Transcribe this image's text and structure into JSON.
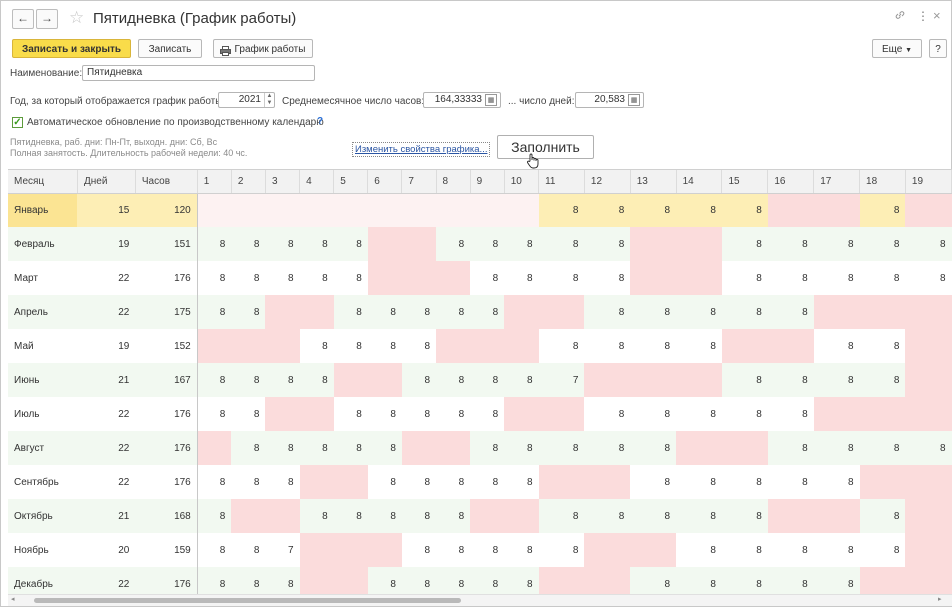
{
  "window": {
    "title": "Пятидневка (График работы)",
    "back_icon": "←",
    "forward_icon": "→",
    "star_icon": "☆",
    "link_icon": "🔗",
    "menu_icon": "⋮",
    "close_icon": "×"
  },
  "toolbar": {
    "save_close": "Записать и закрыть",
    "save": "Записать",
    "schedule": "График работы",
    "more": "Еще",
    "help": "?"
  },
  "form": {
    "name_label": "Наименование:",
    "name_value": "Пятидневка",
    "year_label": "Год, за который отображается график работы:",
    "year_value": "2021",
    "avg_hours_label": "Среднемесячное число часов:",
    "avg_hours_value": "164,33333",
    "avg_days_label": "... число дней:",
    "avg_days_value": "20,583",
    "auto_update_label": "Автоматическое обновление по производственному календарю",
    "auto_update_help": "?",
    "auto_update_checked": true,
    "info_line1": "Пятидневка, раб. дни: Пн-Пт, выходн. дни: Сб, Вс",
    "info_line2": "Полная занятость. Длительность рабочей недели: 40 чс.",
    "change_link": "Изменить свойства графика...",
    "fill_button": "Заполнить"
  },
  "table": {
    "columns": [
      "Месяц",
      "Дней",
      "Часов",
      "1",
      "2",
      "3",
      "4",
      "5",
      "6",
      "7",
      "8",
      "9",
      "10",
      "11",
      "12",
      "13",
      "14",
      "15",
      "16",
      "17",
      "18",
      "19"
    ],
    "rows": [
      {
        "month": "Январь",
        "days": "15",
        "hours": "120",
        "d": [
          "",
          "",
          "",
          "",
          "",
          "",
          "",
          "",
          "",
          "",
          "8",
          "8",
          "8",
          "8",
          "8",
          "",
          "",
          "8",
          ""
        ]
      },
      {
        "month": "Февраль",
        "days": "19",
        "hours": "151",
        "d": [
          "8",
          "8",
          "8",
          "8",
          "8",
          "",
          "",
          "8",
          "8",
          "8",
          "8",
          "8",
          "",
          "",
          "8",
          "8",
          "8",
          "8",
          "8"
        ]
      },
      {
        "month": "Март",
        "days": "22",
        "hours": "176",
        "d": [
          "8",
          "8",
          "8",
          "8",
          "8",
          "",
          "",
          "",
          "8",
          "8",
          "8",
          "8",
          "",
          "",
          "8",
          "8",
          "8",
          "8",
          "8"
        ]
      },
      {
        "month": "Апрель",
        "days": "22",
        "hours": "175",
        "d": [
          "8",
          "8",
          "",
          "",
          "8",
          "8",
          "8",
          "8",
          "8",
          "",
          "",
          "8",
          "8",
          "8",
          "8",
          "8",
          "",
          "",
          ""
        ]
      },
      {
        "month": "Май",
        "days": "19",
        "hours": "152",
        "d": [
          "",
          "",
          "",
          "8",
          "8",
          "8",
          "8",
          "",
          "",
          "",
          "8",
          "8",
          "8",
          "8",
          "",
          "",
          "8",
          "8",
          ""
        ]
      },
      {
        "month": "Июнь",
        "days": "21",
        "hours": "167",
        "d": [
          "8",
          "8",
          "8",
          "8",
          "",
          "",
          "8",
          "8",
          "8",
          "8",
          "7",
          "",
          "",
          "",
          "8",
          "8",
          "8",
          "8",
          ""
        ]
      },
      {
        "month": "Июль",
        "days": "22",
        "hours": "176",
        "d": [
          "8",
          "8",
          "",
          "",
          "8",
          "8",
          "8",
          "8",
          "8",
          "",
          "",
          "8",
          "8",
          "8",
          "8",
          "8",
          "",
          "",
          ""
        ]
      },
      {
        "month": "Август",
        "days": "22",
        "hours": "176",
        "d": [
          "",
          "8",
          "8",
          "8",
          "8",
          "8",
          "",
          "",
          "8",
          "8",
          "8",
          "8",
          "8",
          "",
          "",
          "8",
          "8",
          "8",
          "8"
        ]
      },
      {
        "month": "Сентябрь",
        "days": "22",
        "hours": "176",
        "d": [
          "8",
          "8",
          "8",
          "",
          "",
          "8",
          "8",
          "8",
          "8",
          "8",
          "",
          "",
          "8",
          "8",
          "8",
          "8",
          "8",
          "",
          ""
        ]
      },
      {
        "month": "Октябрь",
        "days": "21",
        "hours": "168",
        "d": [
          "8",
          "",
          "",
          "8",
          "8",
          "8",
          "8",
          "8",
          "",
          "",
          "8",
          "8",
          "8",
          "8",
          "8",
          "",
          "",
          "8",
          ""
        ]
      },
      {
        "month": "Ноябрь",
        "days": "20",
        "hours": "159",
        "d": [
          "8",
          "8",
          "7",
          "",
          "",
          "",
          "8",
          "8",
          "8",
          "8",
          "8",
          "",
          "",
          "8",
          "8",
          "8",
          "8",
          "8",
          ""
        ]
      },
      {
        "month": "Декабрь",
        "days": "22",
        "hours": "176",
        "d": [
          "8",
          "8",
          "8",
          "",
          "",
          "8",
          "8",
          "8",
          "8",
          "8",
          "",
          "",
          "8",
          "8",
          "8",
          "8",
          "8",
          "",
          ""
        ]
      }
    ]
  },
  "colors": {
    "primary": "#f9dc4a",
    "weekend": "#fbdcdc",
    "alt_row": "#f2f9f1",
    "selected_row": "#fdeeb5"
  }
}
